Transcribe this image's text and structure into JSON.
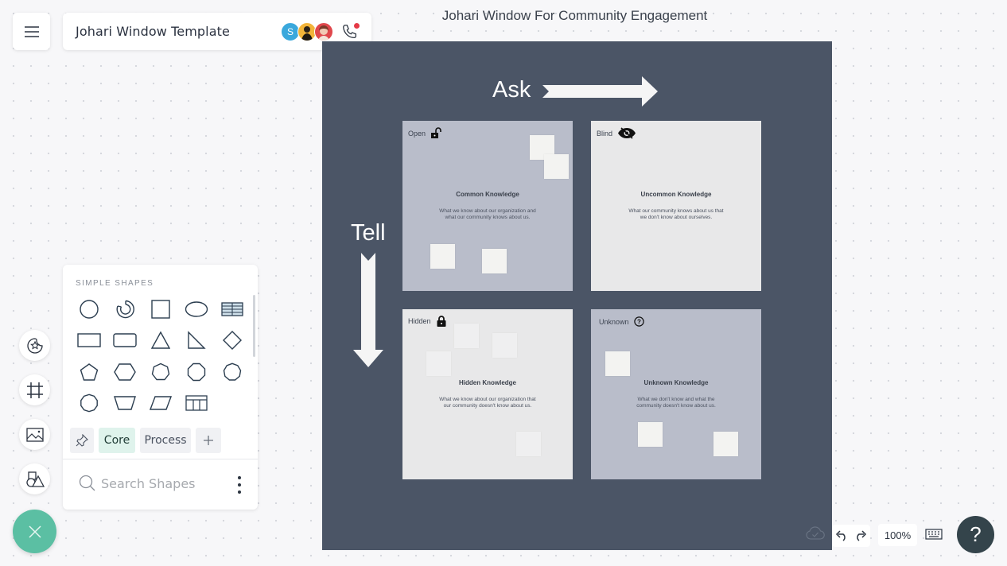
{
  "header": {
    "menu_icon": "hamburger-icon",
    "doc_title": "Johari Window Template",
    "collaborators": [
      {
        "type": "initial",
        "label": "S",
        "color": "#3aa8dc"
      },
      {
        "type": "photo",
        "color": "#f2b43a"
      },
      {
        "type": "photo",
        "color": "#e0474c"
      }
    ],
    "call_icon": "phone-icon",
    "call_indicator_color": "#e53a47"
  },
  "diagram": {
    "title": "Johari Window For Community Engagement",
    "ask_label": "Ask",
    "tell_label": "Tell",
    "background_color": "#4b5566",
    "quadrants": [
      {
        "label": "Open",
        "icon": "unlocked-padlock-icon",
        "title": "Common Knowledge",
        "desc_line1": "What we know about our organization and",
        "desc_line2": "what our community knows about us.",
        "color": "#b9bdca"
      },
      {
        "label": "Blind",
        "icon": "eye-slash-icon",
        "title": "Uncommon Knowledge",
        "desc_line1": "What our community knows about us that",
        "desc_line2": "we don't know about ourselves.",
        "color": "#e8e8e9"
      },
      {
        "label": "Hidden",
        "icon": "locked-padlock-icon",
        "title": "Hidden Knowledge",
        "desc_line1": "What we know about our organization that",
        "desc_line2": "our community doesn't know about us.",
        "color": "#e8e8e9"
      },
      {
        "label": "Unknown",
        "icon": "question-circle-icon",
        "title": "Unknown Knowledge",
        "desc_line1": "What we don't know and what the",
        "desc_line2": "community doesn't know about us.",
        "color": "#b9bdca"
      }
    ]
  },
  "rail": {
    "items": [
      {
        "name": "sticker-icon"
      },
      {
        "name": "frame-icon"
      },
      {
        "name": "image-icon"
      },
      {
        "name": "shapes-icon"
      }
    ],
    "close_icon": "close-icon",
    "fab_color": "#5bbfa3"
  },
  "shapes_panel": {
    "heading": "SIMPLE SHAPES",
    "shapes": [
      "circle",
      "arc-ring",
      "square",
      "ellipse",
      "table-striped",
      "rectangle",
      "rounded-rectangle",
      "triangle",
      "right-triangle",
      "diamond",
      "pentagon",
      "hexagon",
      "heptagon",
      "octagon",
      "nonagon",
      "decagon",
      "trapezoid",
      "parallelogram",
      "grid-table"
    ],
    "tabs": [
      {
        "label": "Core",
        "active": true
      },
      {
        "label": "Process",
        "active": false
      }
    ],
    "pin_icon": "pin-icon",
    "add_icon": "plus-icon",
    "search_placeholder": "Search Shapes",
    "more_icon": "kebab-menu-icon"
  },
  "footer": {
    "sync_icon": "cloud-check-icon",
    "zoom_level": "100%",
    "help_label": "?"
  }
}
